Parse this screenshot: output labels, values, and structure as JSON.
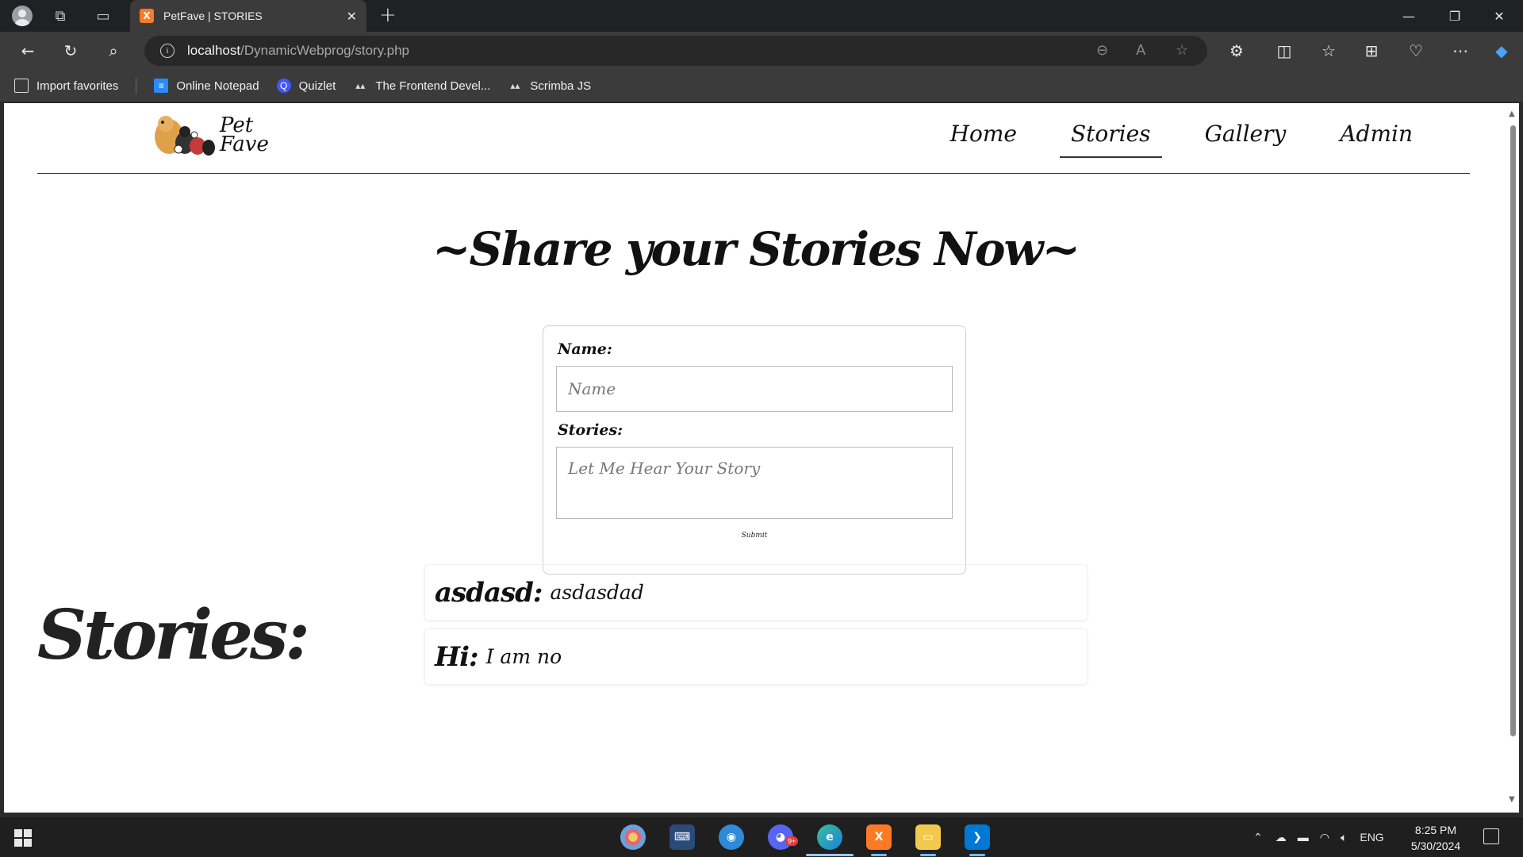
{
  "browser": {
    "tab_title": "PetFave | STORIES",
    "tab_favicon_text": "X",
    "url_host": "localhost",
    "url_path": "/DynamicWebprog/story.php",
    "new_tab_icon": "+",
    "favorites": [
      {
        "label": "Import favorites",
        "icon": "import-icon"
      },
      {
        "label": "Online Notepad",
        "icon": "notepad-icon"
      },
      {
        "label": "Quizlet",
        "icon": "quizlet-icon"
      },
      {
        "label": "The Frontend Devel...",
        "icon": "scrimba-icon"
      },
      {
        "label": "Scrimba JS",
        "icon": "scrimba-icon"
      }
    ]
  },
  "site": {
    "logo_line1": "Pet",
    "logo_line2": "Fave",
    "nav": [
      {
        "label": "Home",
        "active": false
      },
      {
        "label": "Stories",
        "active": true
      },
      {
        "label": "Gallery",
        "active": false
      },
      {
        "label": "Admin",
        "active": false
      }
    ]
  },
  "main": {
    "title": "~Share your Stories Now~",
    "form": {
      "name_label": "Name:",
      "name_placeholder": "Name",
      "name_value": "",
      "stories_label": "Stories:",
      "stories_placeholder": "Let Me Hear Your Story",
      "stories_value": "",
      "submit_label": "Submit"
    },
    "stories_heading": "Stories:",
    "stories": [
      {
        "name": "asdasd:",
        "text": "asdasdad"
      },
      {
        "name": "Hi:",
        "text": "I am no"
      }
    ]
  },
  "taskbar": {
    "language": "ENG",
    "time": "8:25 PM",
    "date": "5/30/2024",
    "badge": "9+"
  },
  "colors": {
    "chrome_bg": "#202124",
    "toolbar_bg": "#3b3b3b",
    "page_bg": "#ffffff",
    "taskbar_bg": "#1f1f1f",
    "xampp_orange": "#fb7a24",
    "vscode_blue": "#0078d4"
  }
}
